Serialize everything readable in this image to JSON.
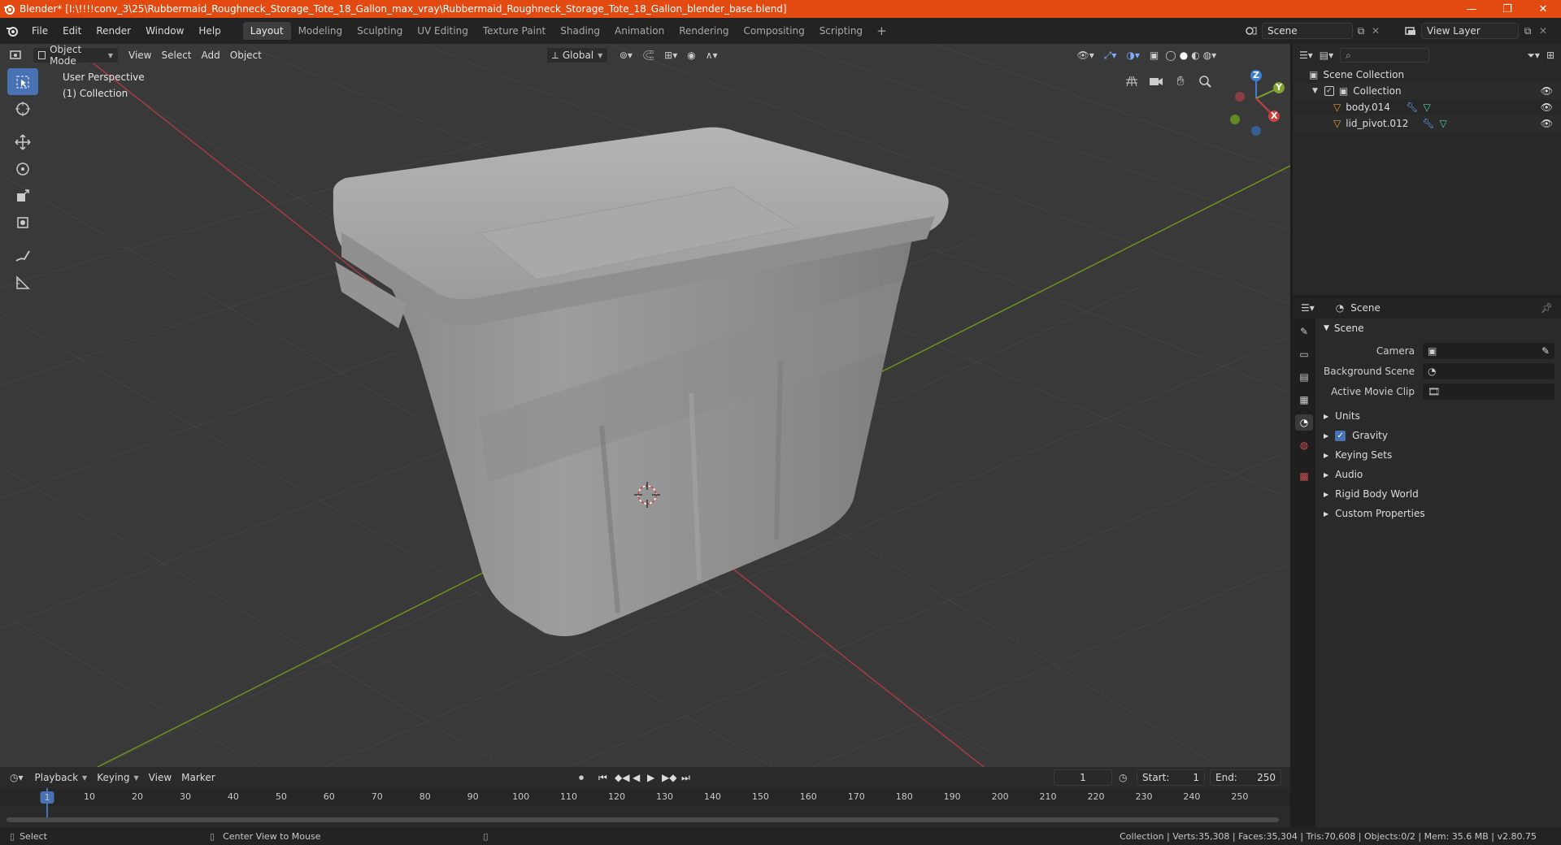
{
  "window": {
    "title": "Blender* [I:\\!!!!conv_3\\25\\Rubbermaid_Roughneck_Storage_Tote_18_Gallon_max_vray\\Rubbermaid_Roughneck_Storage_Tote_18_Gallon_blender_base.blend]",
    "controls": [
      "—",
      "❐",
      "✕"
    ]
  },
  "menu": [
    "File",
    "Edit",
    "Render",
    "Window",
    "Help"
  ],
  "workspaces": {
    "tabs": [
      "Layout",
      "Modeling",
      "Sculpting",
      "UV Editing",
      "Texture Paint",
      "Shading",
      "Animation",
      "Rendering",
      "Compositing",
      "Scripting"
    ],
    "active": "Layout",
    "add": "+"
  },
  "scene_selector": {
    "scene": "Scene",
    "view_layer": "View Layer"
  },
  "viewport_header": {
    "mode": "Object Mode",
    "menus": [
      "View",
      "Select",
      "Add",
      "Object"
    ],
    "transform_orientation": "Global"
  },
  "viewport": {
    "perspective": "User Perspective",
    "collection": "(1) Collection",
    "colors": {
      "background": "#393939",
      "grid": "#434343",
      "x_axis": "#a53c45",
      "y_axis": "#6d9420"
    }
  },
  "gizmo": {
    "x": "X",
    "y": "Y",
    "z": "Z"
  },
  "outliner": {
    "root": "Scene Collection",
    "collection": "Collection",
    "objects": [
      "body.014",
      "lid_pivot.012"
    ]
  },
  "properties": {
    "header": "Scene",
    "panel": "Scene",
    "rows": [
      {
        "label": "Camera"
      },
      {
        "label": "Background Scene"
      },
      {
        "label": "Active Movie Clip"
      }
    ],
    "subpanels": [
      "Units",
      "Gravity",
      "Keying Sets",
      "Audio",
      "Rigid Body World",
      "Custom Properties"
    ]
  },
  "timeline": {
    "menus": [
      "Playback",
      "Keying",
      "View",
      "Marker"
    ],
    "current_frame": "1",
    "start_label": "Start:",
    "start": "1",
    "end_label": "End:",
    "end": "250",
    "ticks": [
      "10",
      "20",
      "30",
      "40",
      "50",
      "60",
      "70",
      "80",
      "90",
      "100",
      "110",
      "120",
      "130",
      "140",
      "150",
      "160",
      "170",
      "180",
      "190",
      "200",
      "210",
      "220",
      "230",
      "240",
      "250"
    ],
    "cursor": "1"
  },
  "statusbar": {
    "left": "Select",
    "middle": "Center View to Mouse",
    "right": "Collection | Verts:35,308 | Faces:35,304 | Tris:70,608 | Objects:0/2 | Mem: 35.6 MB | v2.80.75"
  }
}
